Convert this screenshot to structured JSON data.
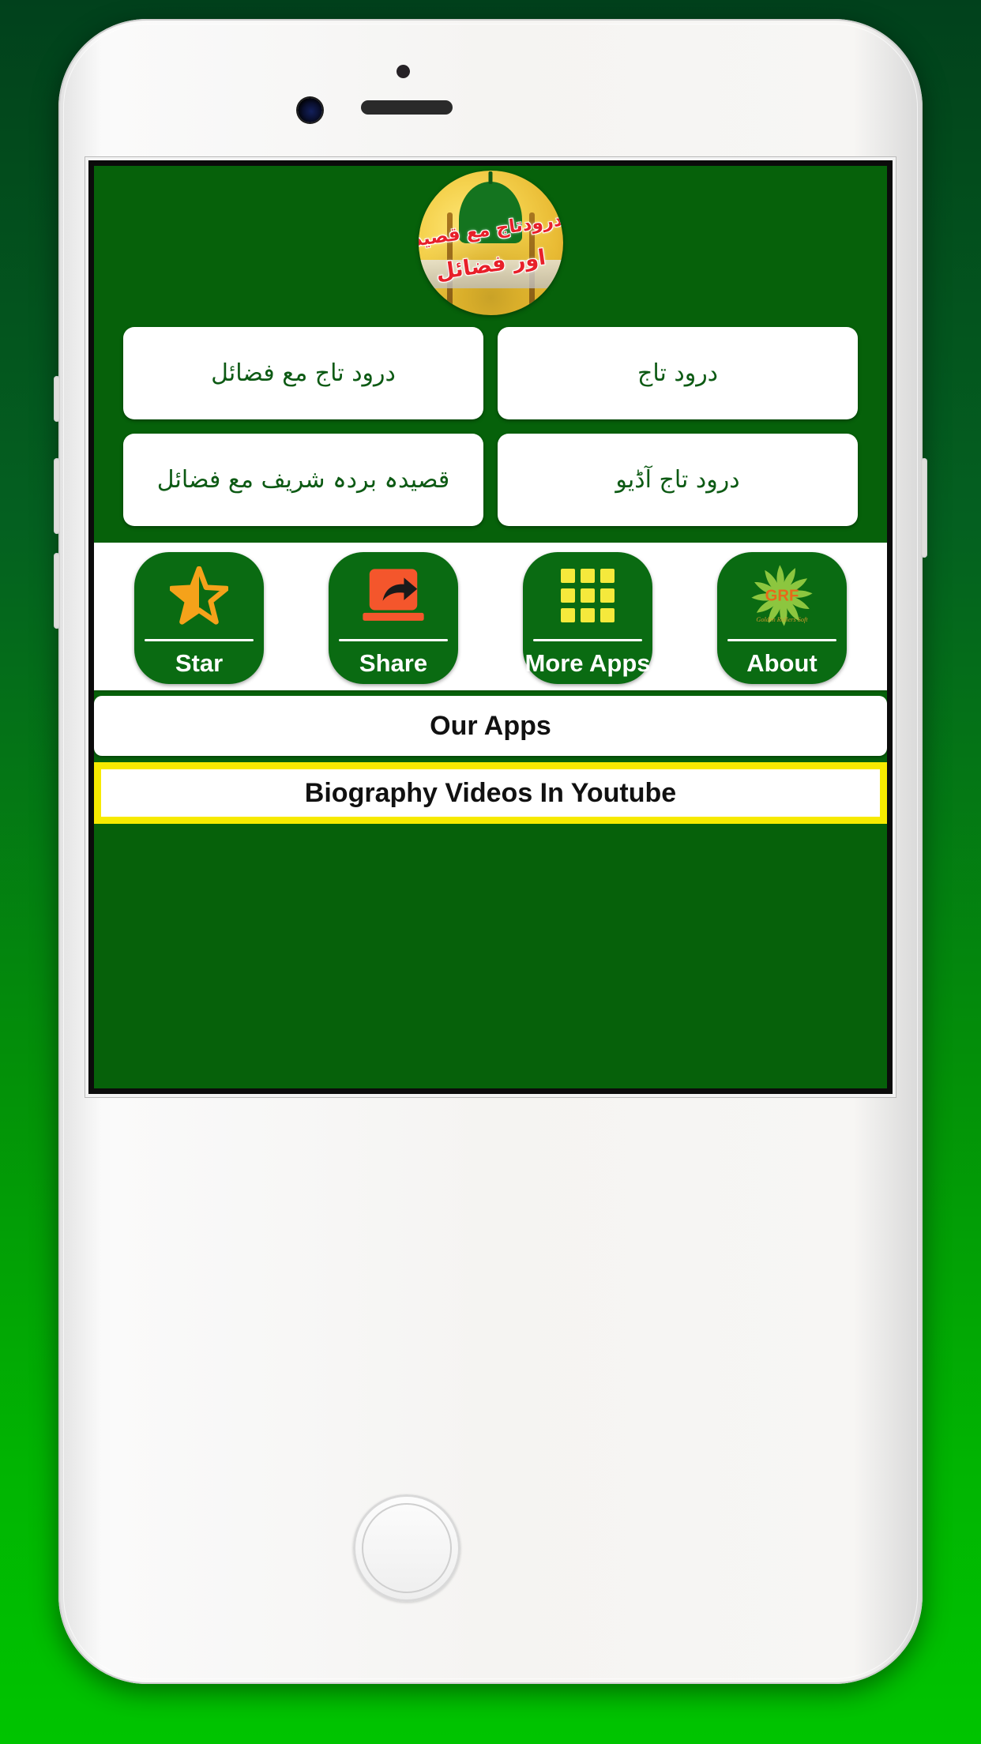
{
  "app": {
    "background_color": "#06610a",
    "screen_border_color": "#0b0b0b",
    "logo": {
      "name": "app-logo",
      "script_line_1": "درودتاج مع قصیدہ بردہ شریف",
      "script_line_2": "اور فضائل",
      "circle_color": "#edc73c",
      "dome_color": "#14741f",
      "script_color": "#e8202a"
    },
    "menu_buttons": [
      {
        "id": "darood-taj-maa-fazail",
        "label": "درود تاج مع فضائل"
      },
      {
        "id": "darood-taj",
        "label": "درود تاج"
      },
      {
        "id": "qaseeda-burda-shareef-maa-fazail",
        "label": "قصیدہ بردہ شریف مع فضائل"
      },
      {
        "id": "darood-taj-audio",
        "label": "درود تاج آڈیو"
      }
    ],
    "icon_bar": [
      {
        "id": "star",
        "label": "Star",
        "icon": "star-icon",
        "icon_color": "#f5a21a"
      },
      {
        "id": "share",
        "label": "Share",
        "icon": "share-icon",
        "icon_color": "#f4562c"
      },
      {
        "id": "more-apps",
        "label": "More Apps",
        "icon": "grid-apps-icon",
        "icon_color": "#f5e93c"
      },
      {
        "id": "about",
        "label": "About",
        "icon": "grf-logo-icon",
        "icon_color": "#8cc63f",
        "icon_text": "GRF",
        "icon_subtext": "Golden Rollers Soft"
      }
    ],
    "our_apps_button": {
      "label": "Our Apps"
    },
    "youtube_button": {
      "label": "Biography Videos In Youtube",
      "border_color": "#f7ea00"
    }
  },
  "device": {
    "frame_color": "#f5f4f2",
    "parts": [
      "sensor-dot",
      "front-camera",
      "earpiece",
      "home-button",
      "volume-buttons",
      "power-button"
    ]
  }
}
